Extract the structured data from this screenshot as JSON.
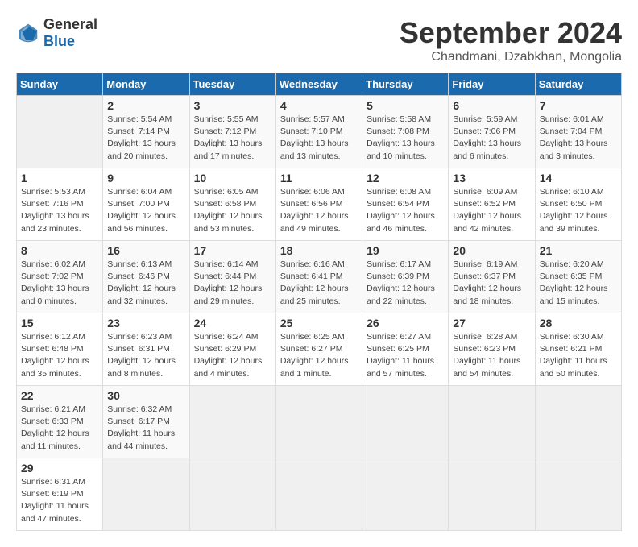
{
  "header": {
    "logo_general": "General",
    "logo_blue": "Blue",
    "month": "September 2024",
    "location": "Chandmani, Dzabkhan, Mongolia"
  },
  "calendar": {
    "columns": [
      "Sunday",
      "Monday",
      "Tuesday",
      "Wednesday",
      "Thursday",
      "Friday",
      "Saturday"
    ],
    "weeks": [
      [
        {
          "num": "",
          "detail": ""
        },
        {
          "num": "2",
          "detail": "Sunrise: 5:54 AM\nSunset: 7:14 PM\nDaylight: 13 hours\nand 20 minutes."
        },
        {
          "num": "3",
          "detail": "Sunrise: 5:55 AM\nSunset: 7:12 PM\nDaylight: 13 hours\nand 17 minutes."
        },
        {
          "num": "4",
          "detail": "Sunrise: 5:57 AM\nSunset: 7:10 PM\nDaylight: 13 hours\nand 13 minutes."
        },
        {
          "num": "5",
          "detail": "Sunrise: 5:58 AM\nSunset: 7:08 PM\nDaylight: 13 hours\nand 10 minutes."
        },
        {
          "num": "6",
          "detail": "Sunrise: 5:59 AM\nSunset: 7:06 PM\nDaylight: 13 hours\nand 6 minutes."
        },
        {
          "num": "7",
          "detail": "Sunrise: 6:01 AM\nSunset: 7:04 PM\nDaylight: 13 hours\nand 3 minutes."
        }
      ],
      [
        {
          "num": "1",
          "detail": "Sunrise: 5:53 AM\nSunset: 7:16 PM\nDaylight: 13 hours\nand 23 minutes."
        },
        {
          "num": "9",
          "detail": "Sunrise: 6:04 AM\nSunset: 7:00 PM\nDaylight: 12 hours\nand 56 minutes."
        },
        {
          "num": "10",
          "detail": "Sunrise: 6:05 AM\nSunset: 6:58 PM\nDaylight: 12 hours\nand 53 minutes."
        },
        {
          "num": "11",
          "detail": "Sunrise: 6:06 AM\nSunset: 6:56 PM\nDaylight: 12 hours\nand 49 minutes."
        },
        {
          "num": "12",
          "detail": "Sunrise: 6:08 AM\nSunset: 6:54 PM\nDaylight: 12 hours\nand 46 minutes."
        },
        {
          "num": "13",
          "detail": "Sunrise: 6:09 AM\nSunset: 6:52 PM\nDaylight: 12 hours\nand 42 minutes."
        },
        {
          "num": "14",
          "detail": "Sunrise: 6:10 AM\nSunset: 6:50 PM\nDaylight: 12 hours\nand 39 minutes."
        }
      ],
      [
        {
          "num": "8",
          "detail": "Sunrise: 6:02 AM\nSunset: 7:02 PM\nDaylight: 13 hours\nand 0 minutes."
        },
        {
          "num": "16",
          "detail": "Sunrise: 6:13 AM\nSunset: 6:46 PM\nDaylight: 12 hours\nand 32 minutes."
        },
        {
          "num": "17",
          "detail": "Sunrise: 6:14 AM\nSunset: 6:44 PM\nDaylight: 12 hours\nand 29 minutes."
        },
        {
          "num": "18",
          "detail": "Sunrise: 6:16 AM\nSunset: 6:41 PM\nDaylight: 12 hours\nand 25 minutes."
        },
        {
          "num": "19",
          "detail": "Sunrise: 6:17 AM\nSunset: 6:39 PM\nDaylight: 12 hours\nand 22 minutes."
        },
        {
          "num": "20",
          "detail": "Sunrise: 6:19 AM\nSunset: 6:37 PM\nDaylight: 12 hours\nand 18 minutes."
        },
        {
          "num": "21",
          "detail": "Sunrise: 6:20 AM\nSunset: 6:35 PM\nDaylight: 12 hours\nand 15 minutes."
        }
      ],
      [
        {
          "num": "15",
          "detail": "Sunrise: 6:12 AM\nSunset: 6:48 PM\nDaylight: 12 hours\nand 35 minutes."
        },
        {
          "num": "23",
          "detail": "Sunrise: 6:23 AM\nSunset: 6:31 PM\nDaylight: 12 hours\nand 8 minutes."
        },
        {
          "num": "24",
          "detail": "Sunrise: 6:24 AM\nSunset: 6:29 PM\nDaylight: 12 hours\nand 4 minutes."
        },
        {
          "num": "25",
          "detail": "Sunrise: 6:25 AM\nSunset: 6:27 PM\nDaylight: 12 hours\nand 1 minute."
        },
        {
          "num": "26",
          "detail": "Sunrise: 6:27 AM\nSunset: 6:25 PM\nDaylight: 11 hours\nand 57 minutes."
        },
        {
          "num": "27",
          "detail": "Sunrise: 6:28 AM\nSunset: 6:23 PM\nDaylight: 11 hours\nand 54 minutes."
        },
        {
          "num": "28",
          "detail": "Sunrise: 6:30 AM\nSunset: 6:21 PM\nDaylight: 11 hours\nand 50 minutes."
        }
      ],
      [
        {
          "num": "22",
          "detail": "Sunrise: 6:21 AM\nSunset: 6:33 PM\nDaylight: 12 hours\nand 11 minutes."
        },
        {
          "num": "30",
          "detail": "Sunrise: 6:32 AM\nSunset: 6:17 PM\nDaylight: 11 hours\nand 44 minutes."
        },
        {
          "num": "",
          "detail": ""
        },
        {
          "num": "",
          "detail": ""
        },
        {
          "num": "",
          "detail": ""
        },
        {
          "num": "",
          "detail": ""
        },
        {
          "num": "",
          "detail": ""
        }
      ],
      [
        {
          "num": "29",
          "detail": "Sunrise: 6:31 AM\nSunset: 6:19 PM\nDaylight: 11 hours\nand 47 minutes."
        },
        {
          "num": "",
          "detail": ""
        },
        {
          "num": "",
          "detail": ""
        },
        {
          "num": "",
          "detail": ""
        },
        {
          "num": "",
          "detail": ""
        },
        {
          "num": "",
          "detail": ""
        },
        {
          "num": "",
          "detail": ""
        }
      ]
    ]
  }
}
